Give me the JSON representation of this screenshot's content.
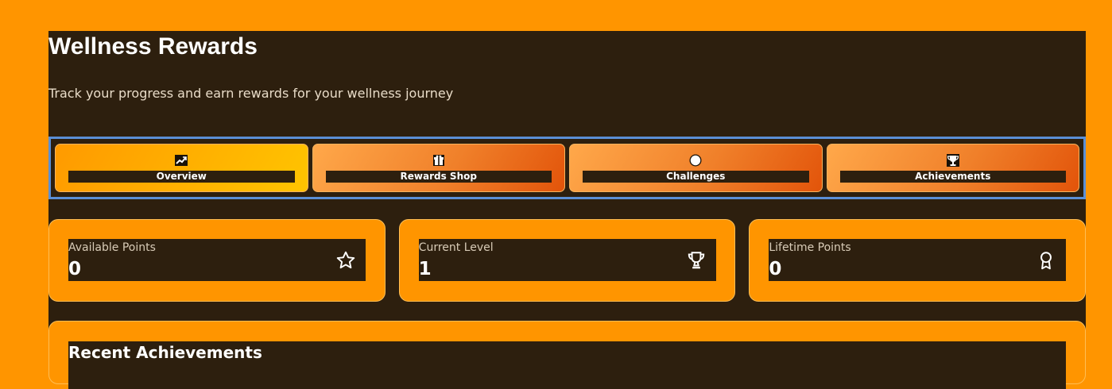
{
  "header": {
    "title": "Wellness Rewards",
    "subtitle": "Track your progress and earn rewards for your wellness journey"
  },
  "tabs": [
    {
      "label": "Overview",
      "icon": "trending-up-icon",
      "active": true
    },
    {
      "label": "Rewards Shop",
      "icon": "gift-icon",
      "active": false
    },
    {
      "label": "Challenges",
      "icon": "target-icon",
      "active": false
    },
    {
      "label": "Achievements",
      "icon": "trophy-icon",
      "active": false
    }
  ],
  "stats": [
    {
      "label": "Available Points",
      "value": "0",
      "icon": "star-icon"
    },
    {
      "label": "Current Level",
      "value": "1",
      "icon": "trophy-icon"
    },
    {
      "label": "Lifetime Points",
      "value": "0",
      "icon": "award-icon"
    }
  ],
  "recent": {
    "title": "Recent Achievements"
  },
  "colors": {
    "background": "#ff9500",
    "panel": "#2d1f0e",
    "tab_border_focus": "#5b8fd6",
    "active_tab_gradient": [
      "#ff9a00",
      "#ffc400"
    ],
    "inactive_tab_gradient": [
      "#ffa84a",
      "#e2540a"
    ]
  }
}
